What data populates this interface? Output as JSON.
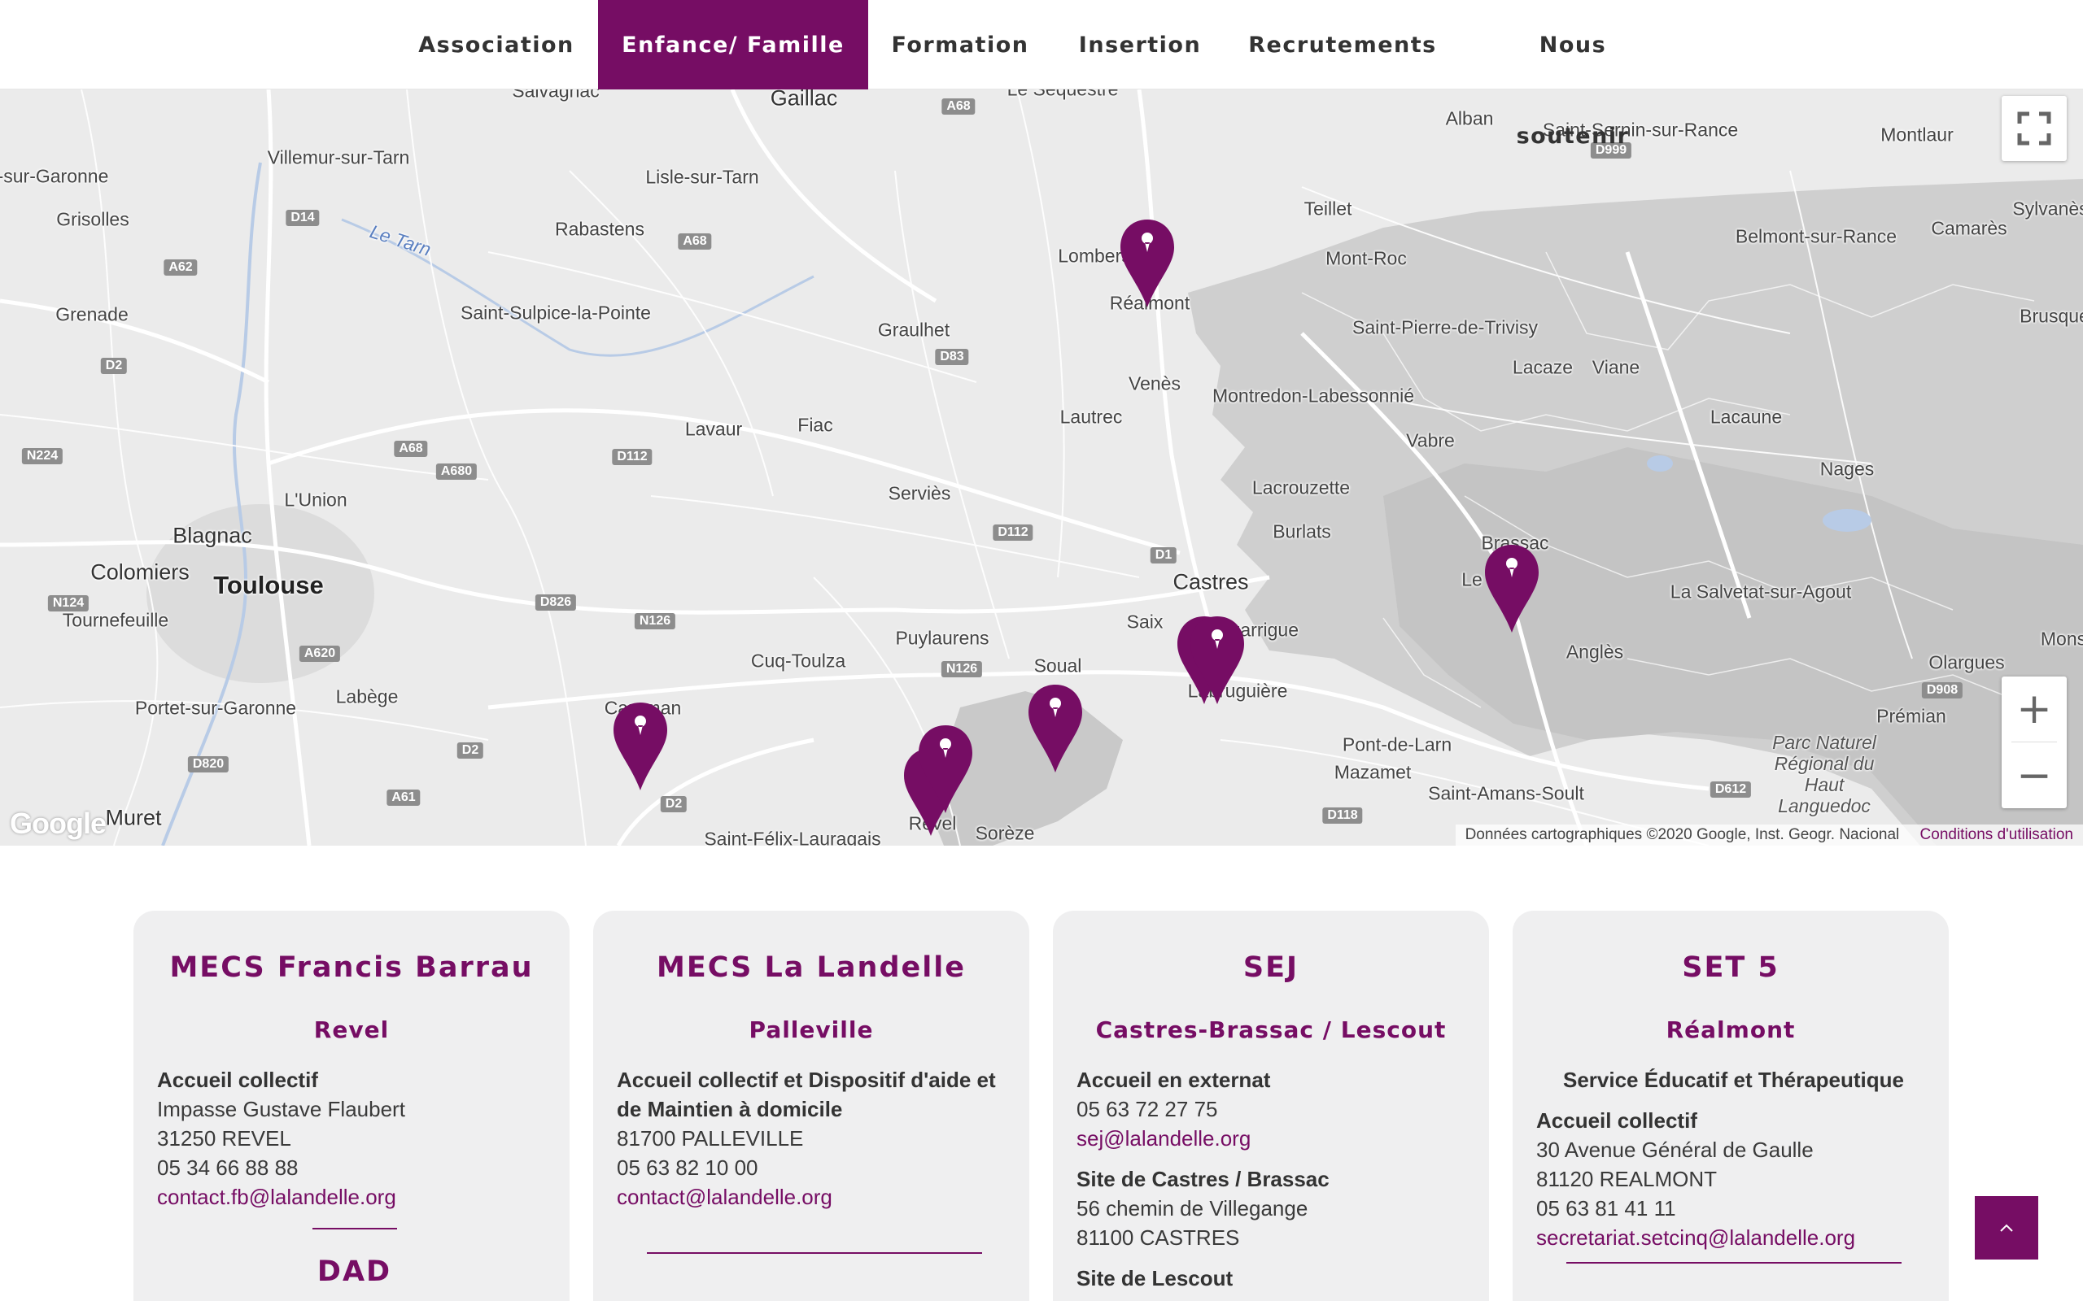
{
  "nav": {
    "items": [
      {
        "label": "Association",
        "active": false
      },
      {
        "label": "Enfance/ Famille",
        "active": true
      },
      {
        "label": "Formation",
        "active": false
      },
      {
        "label": "Insertion",
        "active": false
      },
      {
        "label": "Recrutements",
        "active": false
      },
      {
        "label": "Nous soutenir",
        "active": false
      }
    ]
  },
  "map": {
    "places": {
      "salvagnac": "Salvagnac",
      "gaillac": "Gaillac",
      "le_sequestre": "Le Séquestre",
      "alban": "Alban",
      "saint_sernin": "Saint-Sernin-sur-Rance",
      "montlaur": "Montlaur",
      "sur_garonne": "-sur-Garonne",
      "villemur": "Villemur-sur-Tarn",
      "lisle": "Lisle-sur-Tarn",
      "teillet": "Teillet",
      "sylvanes": "Sylvanès",
      "grisolles": "Grisolles",
      "le_tarn": "Le Tarn",
      "rabastens": "Rabastens",
      "belmont": "Belmont-sur-Rance",
      "camares": "Camarès",
      "lombers": "Lombers",
      "mont_roc": "Mont-Roc",
      "realmont": "Réalmont",
      "grenade": "Grenade",
      "saint_sulpice": "Saint-Sulpice-la-Pointe",
      "brusque": "Brusque",
      "graulhet": "Graulhet",
      "saint_pierre": "Saint-Pierre-de-Trivisy",
      "lacaze": "Lacaze",
      "viane": "Viane",
      "venes": "Venès",
      "montredon": "Montredon-Labessonnié",
      "lautrec": "Lautrec",
      "lacaune": "Lacaune",
      "lavaur": "Lavaur",
      "fiac": "Fiac",
      "vabre": "Vabre",
      "nages": "Nages",
      "lacrouzette": "Lacrouzette",
      "l_union": "L'Union",
      "servies": "Serviès",
      "blagnac": "Blagnac",
      "burlats": "Burlats",
      "brassac": "Brassac",
      "colomiers": "Colomiers",
      "toulouse": "Toulouse",
      "castres": "Castres",
      "le_bez": "Le Bez",
      "la_salvetat": "La Salvetat-sur-Agout",
      "tournefeuille": "Tournefeuille",
      "saix": "Saix",
      "lagarrique": "Lagarrigue",
      "puylaurens": "Puylaurens",
      "soual": "Soual",
      "angles": "Anglès",
      "olargues": "Olargues",
      "mons": "Mons",
      "cuq_toulza": "Cuq-Toulza",
      "caraman": "Caraman",
      "labege": "Labège",
      "labruguiere": "Labruguière",
      "premian": "Prémian",
      "portet": "Portet-sur-Garonne",
      "parc": "Parc Naturel Régional du Haut Languedoc",
      "pont_de_larn": "Pont-de-Larn",
      "mazamet": "Mazamet",
      "saint_amans": "Saint-Amans-Soult",
      "muret": "Muret",
      "revel": "Revel",
      "soreze": "Sorèze",
      "saint_felix": "Saint-Félix-Lauragais"
    },
    "roads": {
      "a68a": "A68",
      "d999": "D999",
      "d14": "D14",
      "a68b": "A68",
      "a62": "A62",
      "d2a": "D2",
      "d83": "D83",
      "n224": "N224",
      "a68c": "A68",
      "a680": "A680",
      "d112": "D112",
      "d112b": "D112",
      "d1": "D1",
      "n124": "N124",
      "d826": "D826",
      "n126a": "N126",
      "a620": "A620",
      "n126b": "N126",
      "d908": "D908",
      "d820": "D820",
      "d2b": "D2",
      "a61": "A61",
      "d2c": "D2",
      "d118": "D118",
      "d612": "D612"
    },
    "google_logo": "Google",
    "attribution": "Données cartographiques ©2020 Google, Inst. Geogr. Nacional",
    "terms": "Conditions d'utilisation",
    "pin_color": "#760d64"
  },
  "cards": [
    {
      "title": "MECS Francis Barrau",
      "subtitle": "Revel",
      "type": "Accueil collectif",
      "address1": "Impasse Gustave Flaubert",
      "address2": "31250 REVEL",
      "phone": "05 34 66 88 88",
      "email": "contact.fb@lalandelle.org",
      "next_title": "DAD"
    },
    {
      "title": "MECS La Landelle",
      "subtitle": "Palleville",
      "type": "Accueil collectif et Dispositif d'aide et de Maintien à domicile",
      "address1": "81700 PALLEVILLE",
      "phone": "05 63 82 10 00",
      "email": "contact@lalandelle.org"
    },
    {
      "title": "SEJ",
      "subtitle": "Castres-Brassac / Lescout",
      "type": "Accueil en externat",
      "phone": "05 63 72 27 75",
      "email": "sej@lalandelle.org",
      "site1_title": "Site  de Castres / Brassac",
      "site1_address1": "56 chemin de Villegange",
      "site1_address2": "81100 CASTRES",
      "site2_title": "Site de Lescout"
    },
    {
      "title": "SET 5",
      "subtitle": "Réalmont",
      "service": "Service Éducatif et Thérapeutique",
      "type": "Accueil collectif",
      "address1": "30 Avenue Général de Gaulle",
      "address2": "81120 REALMONT",
      "phone": "05 63 81 41 11",
      "email": "secretariat.setcinq@lalandelle.org"
    }
  ],
  "accent_color": "#760d64"
}
